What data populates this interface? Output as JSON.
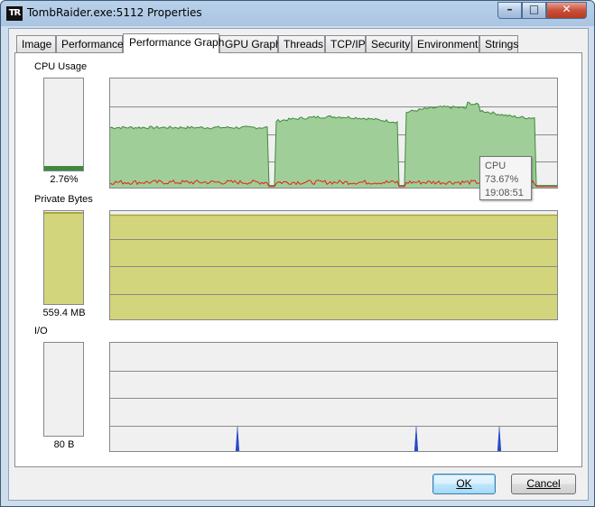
{
  "window": {
    "title": "TombRaider.exe:5112 Properties",
    "app_icon_text": "TR"
  },
  "caption_buttons": {
    "minimize": "–",
    "maximize": "□",
    "close": "✕"
  },
  "tabs": [
    {
      "label": "Image"
    },
    {
      "label": "Performance"
    },
    {
      "label": "Performance Graph",
      "active": true
    },
    {
      "label": "GPU Graph"
    },
    {
      "label": "Threads"
    },
    {
      "label": "TCP/IP"
    },
    {
      "label": "Security"
    },
    {
      "label": "Environment"
    },
    {
      "label": "Strings"
    }
  ],
  "cpu": {
    "label": "CPU Usage",
    "value": "2.76%",
    "gauge_fraction": 0.0276
  },
  "private_bytes": {
    "label": "Private Bytes",
    "value": "559.4 MB",
    "gauge_fraction": 0.97
  },
  "io": {
    "label": "I/O",
    "value": "80 B",
    "gauge_fraction": 0
  },
  "tooltip": {
    "name": "CPU",
    "value": "73.67%",
    "time": "19:08:51"
  },
  "buttons": {
    "ok": "OK",
    "cancel": "Cancel"
  },
  "colors": {
    "cpu_fill": "#a0ce98",
    "cpu_line": "#3e8a3a",
    "cpu_kernel": "#e81e1e",
    "bytes_fill": "#d3d57c",
    "bytes_line": "#a7a832",
    "io_line": "#2848c8",
    "gauge_bg": "#f0f0f0",
    "grid": "#8a8a8a"
  }
}
